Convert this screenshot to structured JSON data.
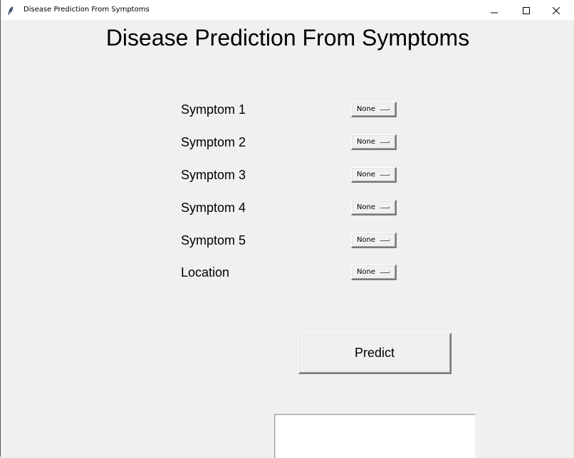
{
  "window": {
    "title": "Disease Prediction From Symptoms",
    "controls": {
      "minimize": "minimize",
      "maximize": "maximize",
      "close": "close"
    }
  },
  "main": {
    "heading": "Disease Prediction From Symptoms",
    "fields": [
      {
        "label": "Symptom 1",
        "value": "None"
      },
      {
        "label": "Symptom 2",
        "value": "None"
      },
      {
        "label": "Symptom 3",
        "value": "None"
      },
      {
        "label": "Symptom 4",
        "value": "None"
      },
      {
        "label": "Symptom 5",
        "value": "None"
      },
      {
        "label": "Location",
        "value": "None"
      }
    ],
    "predict_label": "Predict",
    "result_text": ""
  }
}
